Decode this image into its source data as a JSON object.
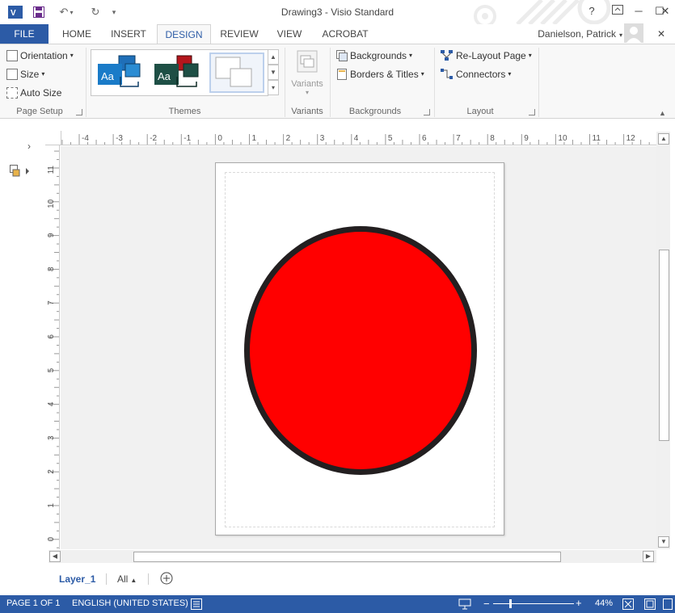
{
  "window": {
    "title": "Drawing3 - Visio Standard",
    "help": "?",
    "minimize": "─",
    "maximize": "☐",
    "close": "✕",
    "ribbon_close": "✕"
  },
  "user": {
    "name": "Danielson, Patrick"
  },
  "tabs": [
    "FILE",
    "HOME",
    "INSERT",
    "DESIGN",
    "REVIEW",
    "VIEW",
    "ACROBAT"
  ],
  "active_tab": "DESIGN",
  "ribbon": {
    "page_setup": {
      "orientation": "Orientation",
      "size": "Size",
      "auto_size": "Auto Size",
      "label": "Page Setup"
    },
    "themes": {
      "label": "Themes",
      "thumb_text_1": "Aa",
      "thumb_text_2": "Aa"
    },
    "variants": {
      "button": "Variants",
      "label": "Variants"
    },
    "backgrounds": {
      "backgrounds_btn": "Backgrounds",
      "borders_btn": "Borders & Titles",
      "label": "Backgrounds"
    },
    "layout": {
      "relayout_btn": "Re-Layout Page",
      "connectors_btn": "Connectors",
      "label": "Layout"
    }
  },
  "ruler_top": [
    "-4",
    "-3",
    "-2",
    "-1",
    "0",
    "1",
    "2",
    "3",
    "4",
    "5",
    "6",
    "7",
    "8",
    "9",
    "10",
    "11",
    "12"
  ],
  "ruler_left": [
    "11",
    "10",
    "9",
    "8",
    "7",
    "6",
    "5",
    "4",
    "3",
    "2",
    "1",
    "0"
  ],
  "layers": {
    "active": "Layer_1",
    "all": "All"
  },
  "status": {
    "page": "PAGE 1 OF 1",
    "language": "ENGLISH (UNITED STATES)",
    "zoom": "44%"
  },
  "colors": {
    "accent": "#2c5ba6",
    "shape_fill": "#ff0000",
    "shape_stroke": "#231f20"
  },
  "zoom_level": 0.44
}
